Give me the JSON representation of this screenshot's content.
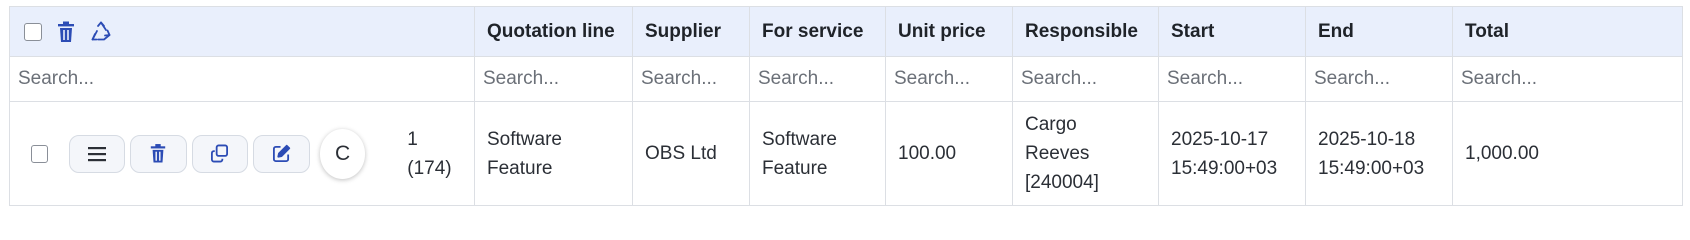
{
  "colors": {
    "header_bg": "#e9effc",
    "icon_blue": "#2c4cb5",
    "border": "#dcdfe4"
  },
  "toolbar": {
    "select_all_icon": "checkbox-icon",
    "delete_icon": "trash-icon",
    "recycle_icon": "recycle-icon"
  },
  "columns": [
    {
      "key": "quotation_line",
      "label": "Quotation line"
    },
    {
      "key": "supplier",
      "label": "Supplier"
    },
    {
      "key": "for_service",
      "label": "For service"
    },
    {
      "key": "unit_price",
      "label": "Unit price"
    },
    {
      "key": "responsible",
      "label": "Responsible"
    },
    {
      "key": "start",
      "label": "Start"
    },
    {
      "key": "end",
      "label": "End"
    },
    {
      "key": "total",
      "label": "Total"
    }
  ],
  "search": {
    "placeholder": "Search...",
    "placeholder_short": "Search..."
  },
  "rows": [
    {
      "actions": [
        "menu-icon",
        "trash-icon",
        "copy-icon",
        "edit-icon"
      ],
      "avatar": "C",
      "id": "1 (174)",
      "quotation_line": "Software Feature",
      "supplier": "OBS Ltd",
      "for_service": "Software Feature",
      "unit_price": "100.00",
      "responsible": "Cargo Reeves [240004]",
      "start": "2025-10-17 15:49:00+03",
      "end": "2025-10-18 15:49:00+03",
      "total": "1,000.00"
    }
  ]
}
